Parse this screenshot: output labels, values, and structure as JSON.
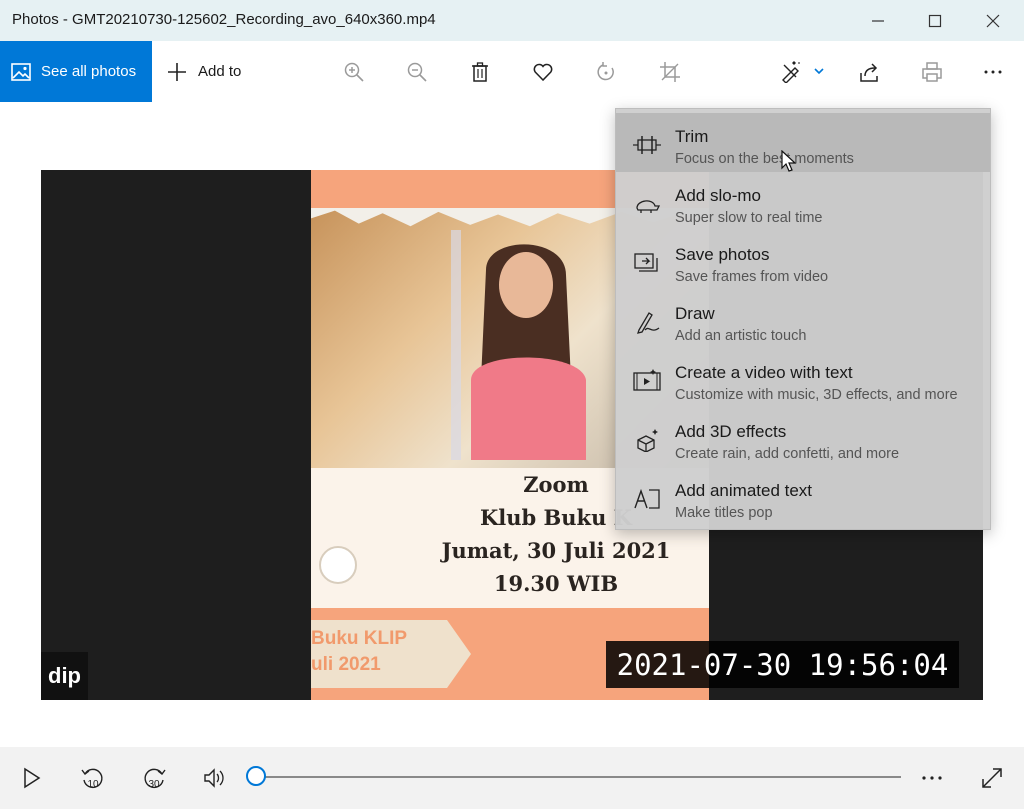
{
  "window": {
    "title": "Photos - GMT20210730-125602_Recording_avo_640x360.mp4"
  },
  "toolbar": {
    "see_all_label": "See all photos",
    "add_to_label": "Add to",
    "icons": [
      "zoom-in-icon",
      "zoom-out-icon",
      "delete-icon",
      "favorite-icon",
      "rotate-icon",
      "crop-icon",
      "edit-create-icon",
      "share-icon",
      "print-icon",
      "more-icon"
    ]
  },
  "video": {
    "card_lines": [
      "Zoom",
      "Klub Buku K",
      "Jumat, 30 Juli 2021",
      "19.30 WIB"
    ],
    "bottom_lines": [
      "Buku KLIP",
      "uli 2021"
    ],
    "watermark": "dip",
    "timestamp": "2021-07-30 19:56:04"
  },
  "edit_menu": {
    "items": [
      {
        "title": "Trim",
        "subtitle": "Focus on the best moments",
        "icon": "trim-icon"
      },
      {
        "title": "Add slo-mo",
        "subtitle": "Super slow to real time",
        "icon": "slomo-icon"
      },
      {
        "title": "Save photos",
        "subtitle": "Save frames from video",
        "icon": "save-photos-icon"
      },
      {
        "title": "Draw",
        "subtitle": "Add an artistic touch",
        "icon": "draw-icon"
      },
      {
        "title": "Create a video with text",
        "subtitle": "Customize with music, 3D effects, and more",
        "icon": "video-text-icon"
      },
      {
        "title": "Add 3D effects",
        "subtitle": "Create rain, add confetti, and more",
        "icon": "3d-effects-icon"
      },
      {
        "title": "Add animated text",
        "subtitle": "Make titles pop",
        "icon": "animated-text-icon"
      }
    ]
  },
  "player": {
    "skip_back_label": "10",
    "skip_forward_label": "30",
    "progress": 0.0
  },
  "colors": {
    "accent": "#0078d7",
    "titlebar": "#e6f1f3"
  }
}
